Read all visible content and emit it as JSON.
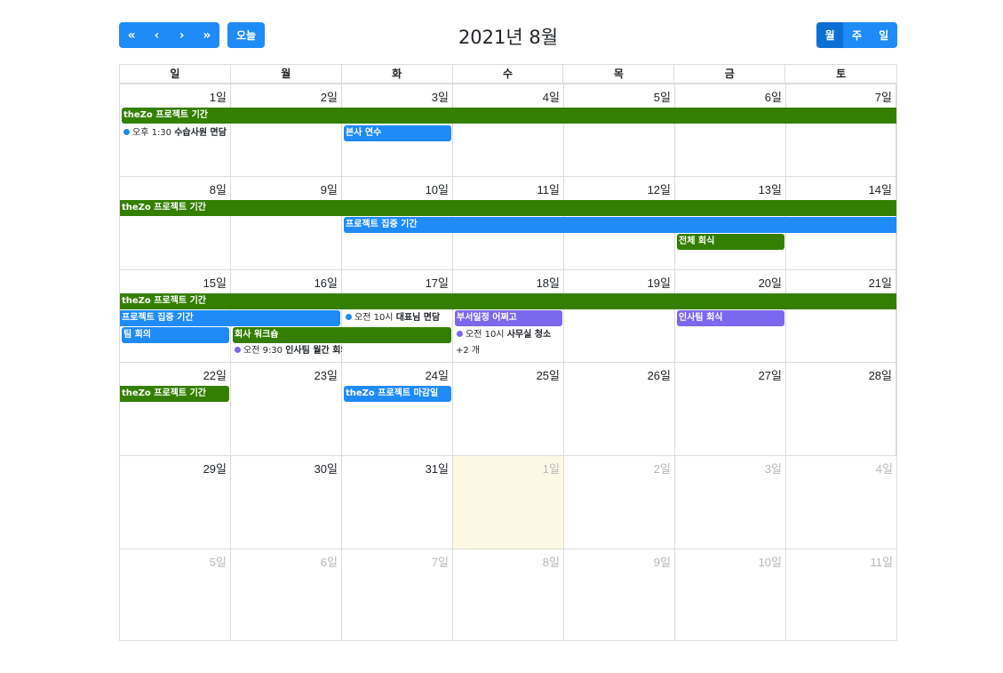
{
  "toolbar": {
    "nav_buttons": [
      "«",
      "‹",
      "›",
      "»"
    ],
    "today_label": "오늘",
    "title": "2021년 8월",
    "views": [
      "월",
      "주",
      "일"
    ],
    "active_view": "월"
  },
  "colors": {
    "accent": "#1e8bf7",
    "green": "#347f00",
    "purple": "#7b68ee",
    "today": "#fcf8e3"
  },
  "weekdays": [
    "일",
    "월",
    "화",
    "수",
    "목",
    "금",
    "토"
  ],
  "weeks": [
    [
      "1일",
      "2일",
      "3일",
      "4일",
      "5일",
      "6일",
      "7일"
    ],
    [
      "8일",
      "9일",
      "10일",
      "11일",
      "12일",
      "13일",
      "14일"
    ],
    [
      "15일",
      "16일",
      "17일",
      "18일",
      "19일",
      "20일",
      "21일"
    ],
    [
      "22일",
      "23일",
      "24일",
      "25일",
      "26일",
      "27일",
      "28일"
    ],
    [
      "29일",
      "30일",
      "31일",
      "1일",
      "2일",
      "3일",
      "4일"
    ],
    [
      "5일",
      "6일",
      "7일",
      "8일",
      "9일",
      "10일",
      "11일"
    ]
  ],
  "events": {
    "w1_project": "theZo 프로젝트 기간",
    "w1_interview_time": "오후 1:30",
    "w1_interview": "수습사원 면담",
    "w1_training": "본사 연수",
    "w2_project": "theZo 프로젝트 기간",
    "w2_focus": "프로젝트 집중 기간",
    "w2_dinner": "전체 회식",
    "w3_project": "theZo 프로젝트 기간",
    "w3_focus": "프로젝트 집중 기간",
    "w3_ceo_time": "오전 10시",
    "w3_ceo": "대표님 면담",
    "w3_dept": "부서일정 어쩌고",
    "w3_hr_dinner": "인사팀 회식",
    "w3_team": "팀 회의",
    "w3_workshop": "회사 워크숍",
    "w3_clean_time": "오전 10시",
    "w3_clean": "사무실 청소",
    "w3_hr_time": "오전 9:30",
    "w3_hr_meeting": "인사팀 월간 회의",
    "w3_more": "+2 개",
    "w4_project": "theZo 프로젝트 기간",
    "w4_deadline": "theZo 프로젝트 마감일"
  }
}
